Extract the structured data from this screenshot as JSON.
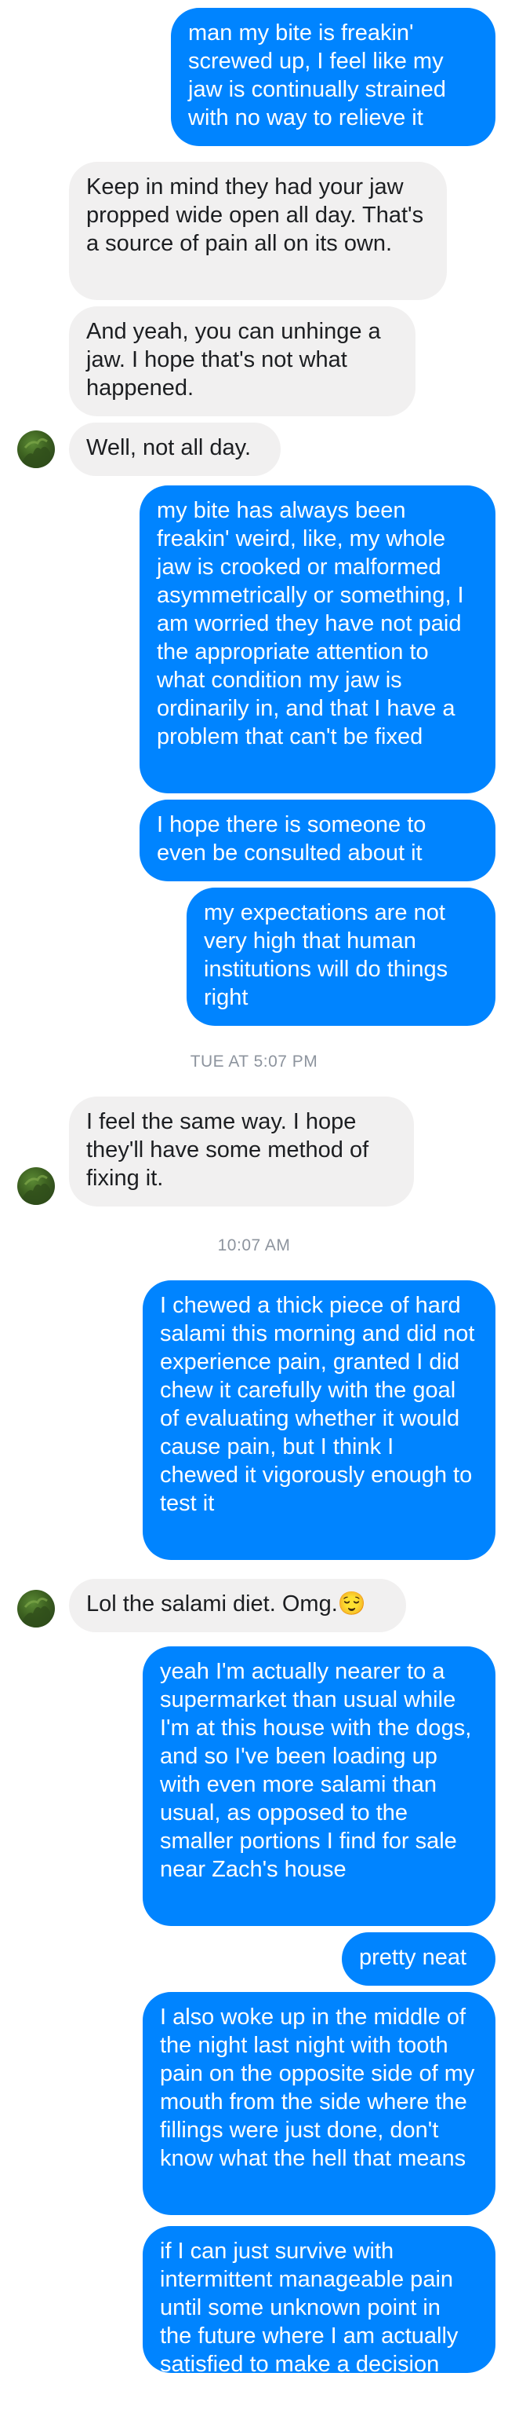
{
  "contact": {
    "avatar_icon": "contact-avatar-icon",
    "avatar_colors": [
      "#24391a",
      "#3c6020",
      "#5b8a34"
    ]
  },
  "colors": {
    "outgoing_bubble": "#0084ff",
    "incoming_bubble": "#f1f0f0",
    "outgoing_text": "#ffffff",
    "incoming_text": "#1c1e21",
    "timestamp_text": "#8d949e"
  },
  "timestamps": {
    "t1": "TUE AT 5:07 PM",
    "t2": "10:07 AM"
  },
  "messages": [
    {
      "dir": "out",
      "text": "man my bite is freakin' screwed up, I feel like my jaw is continually strained with no way to relieve it"
    },
    {
      "dir": "in",
      "text": "Keep in mind they had your jaw propped wide open all day. That's a source of pain all on its own."
    },
    {
      "dir": "in",
      "text": "And yeah, you can unhinge a jaw. I hope that's not what happened."
    },
    {
      "dir": "in",
      "text": "Well, not all day."
    },
    {
      "dir": "out",
      "text": "my bite has always been freakin' weird, like, my whole jaw is crooked or malformed asymmetrically or something, I am worried they have not paid the appropriate attention to what condition my jaw is ordinarily in, and that I have a problem that can't be fixed"
    },
    {
      "dir": "out",
      "text": "I hope there is someone to even be consulted about it"
    },
    {
      "dir": "out",
      "text": "my expectations are not very high that human institutions will do things right"
    },
    {
      "dir": "in",
      "text": "I feel the same way. I hope they'll have some method of fixing it."
    },
    {
      "dir": "out",
      "text": "I chewed a thick piece of hard salami this morning and did not experience pain, granted I did chew it carefully with the goal of evaluating whether it would cause pain, but I think I chewed it vigorously enough to test it"
    },
    {
      "dir": "in",
      "text": "Lol the salami diet. Omg.😌"
    },
    {
      "dir": "out",
      "text": "yeah I'm actually nearer to a supermarket than usual while I'm at this house with the dogs, and so I've been loading up with even more salami than usual, as opposed to the smaller portions I find for sale near Zach's house"
    },
    {
      "dir": "out",
      "text": "pretty neat"
    },
    {
      "dir": "out",
      "text": "I also woke up in the middle of the night last night with tooth pain on the opposite side of my mouth from the side where the fillings were just done, don't know what the hell that means"
    },
    {
      "dir": "out",
      "text": "if I can just survive with intermittent manageable pain until some unknown point in the future where I am actually satisfied to make a decision about a surgery, that would be swell"
    }
  ]
}
